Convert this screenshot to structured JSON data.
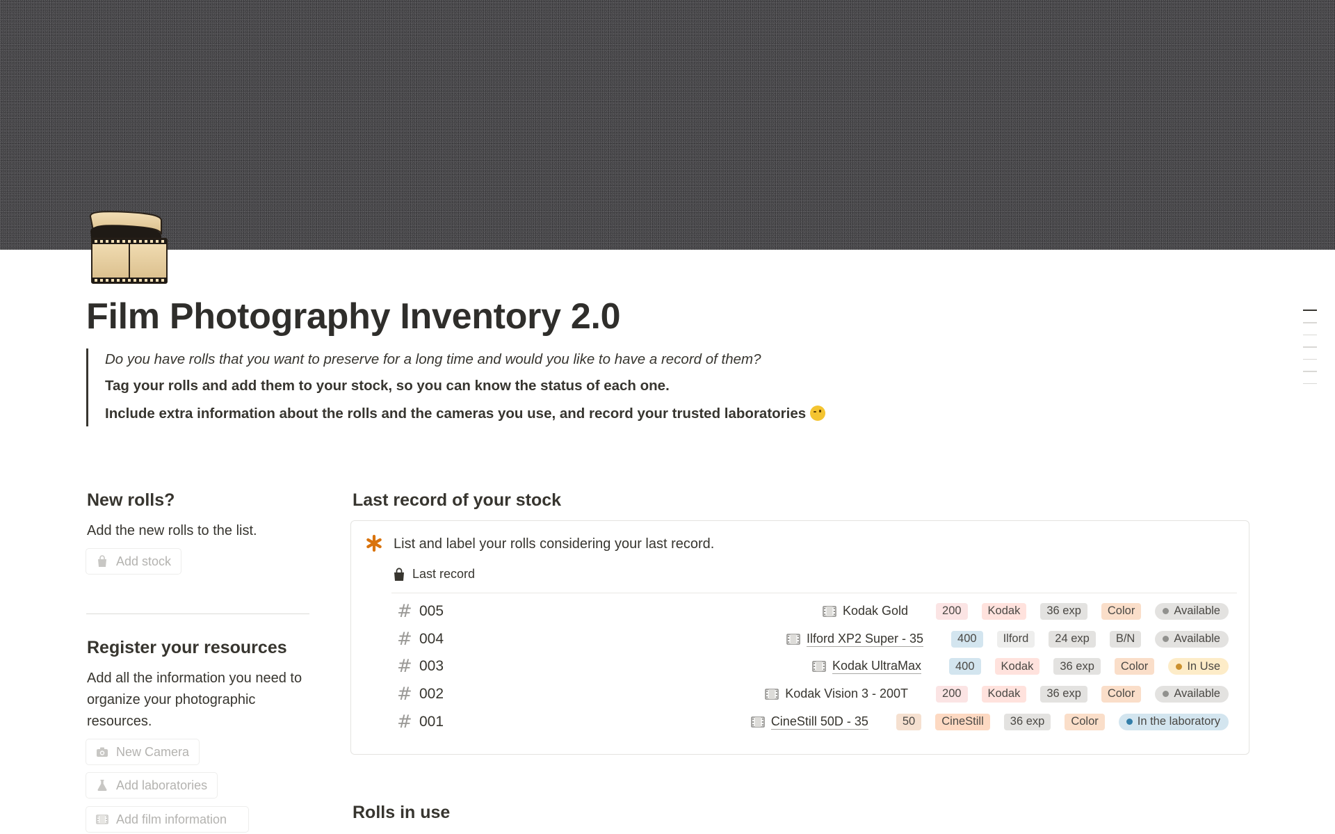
{
  "page": {
    "title": "Film Photography Inventory 2.0",
    "icon": "film-roll-icon"
  },
  "intro": {
    "line1": "Do you have rolls that you want to preserve for a long time and would you like to have a record of them?",
    "line2": "Tag your rolls and add them to your stock, so you can know the status of each one.",
    "line3": "Include extra information about the rolls and the cameras you use, and record your trusted laboratories",
    "line3_emoji": "winking-face-emoji"
  },
  "new_rolls": {
    "heading": "New rolls?",
    "text": "Add the new rolls to the list.",
    "button": "Add stock",
    "button_icon": "shopping-bag-icon"
  },
  "resources": {
    "heading": "Register your resources",
    "text": "Add all the information you need to organize your photographic resources.",
    "buttons": [
      {
        "label": "New Camera",
        "icon": "camera-icon"
      },
      {
        "label": "Add laboratories",
        "icon": "flask-icon"
      },
      {
        "label": "Add film information",
        "icon": "film-icon"
      }
    ]
  },
  "stock": {
    "heading": "Last record of your stock",
    "callout_text": "List and label your rolls considering your last record.",
    "callout_icon": "asterisk-icon",
    "view_name": "Last record",
    "view_icon": "shopping-bag-icon",
    "rows": [
      {
        "id": "005",
        "film": "Kodak Gold",
        "iso": "200",
        "brand": "Kodak",
        "exposures": "36 exp",
        "type": "Color",
        "status": "Available"
      },
      {
        "id": "004",
        "film": "Ilford XP2 Super - 35",
        "iso": "400",
        "brand": "Ilford",
        "exposures": "24 exp",
        "type": "B/N",
        "status": "Available"
      },
      {
        "id": "003",
        "film": "Kodak UltraMax",
        "iso": "400",
        "brand": "Kodak",
        "exposures": "36 exp",
        "type": "Color",
        "status": "In Use"
      },
      {
        "id": "002",
        "film": "Kodak Vision 3 - 200T",
        "iso": "200",
        "brand": "Kodak",
        "exposures": "36 exp",
        "type": "Color",
        "status": "Available"
      },
      {
        "id": "001",
        "film": "CineStill 50D - 35",
        "iso": "50",
        "brand": "CineStill",
        "exposures": "36 exp",
        "type": "Color",
        "status": "In the laboratory"
      }
    ]
  },
  "rolls_in_use": {
    "heading": "Rolls in use"
  },
  "colors": {
    "iso_200": "#fbe4e4",
    "iso_400": "#d3e5ef",
    "iso_50": "#f5e0d0",
    "brand_kodak": "#ffe2dd",
    "brand_ilford": "#eeeeed",
    "brand_cinestill": "#fdd9c2",
    "exposures": "#e3e2e0",
    "type_color": "#fadec9",
    "type_bn": "#e3e2e0",
    "status_available_bg": "#e3e2e0",
    "status_available_dot": "#91918e",
    "status_inuse_bg": "#fdecc8",
    "status_inuse_dot": "#cb912f",
    "status_lab_bg": "#d3e5ef",
    "status_lab_dot": "#337ea9",
    "accent_asterisk": "#d9730d"
  }
}
